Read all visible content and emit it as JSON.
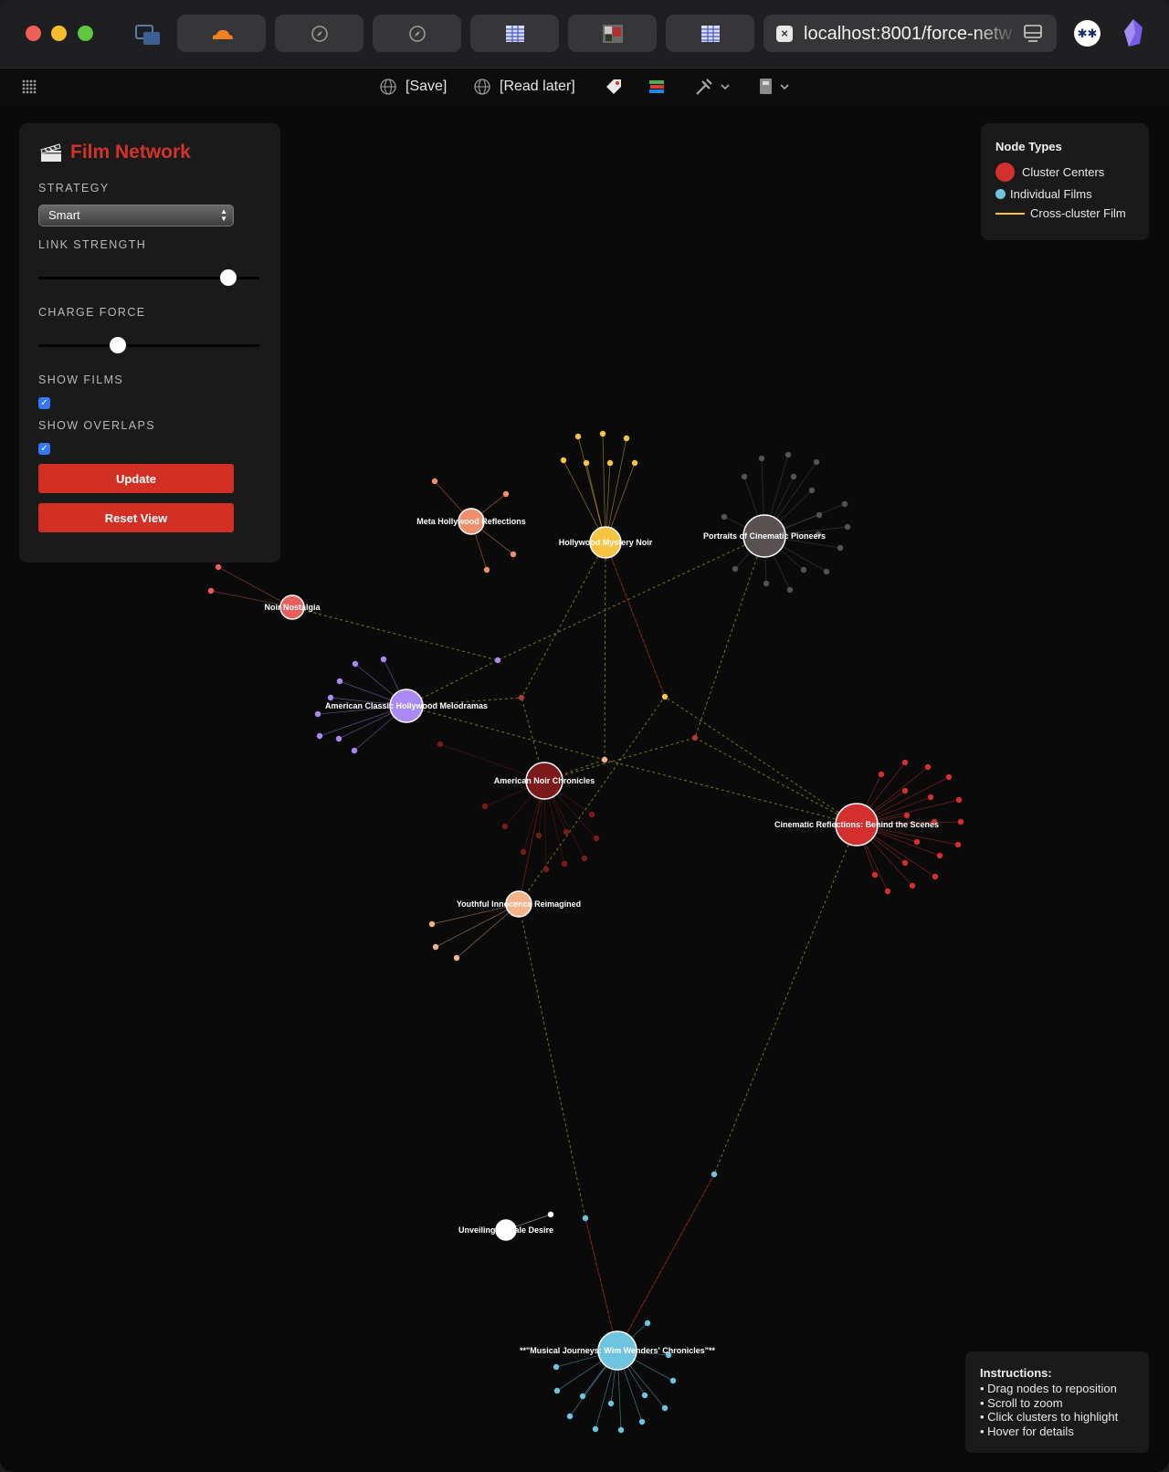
{
  "browser": {
    "url": "localhost:8001/force-netw",
    "tabs": [
      {
        "icon": "cloudflare-icon"
      },
      {
        "icon": "compass-icon"
      },
      {
        "icon": "compass-icon"
      },
      {
        "icon": "table-icon"
      },
      {
        "icon": "film-thumbnail-icon"
      },
      {
        "icon": "table-icon"
      }
    ],
    "extension_label": "✱✱"
  },
  "bookmarks": {
    "save": "[Save]",
    "read_later": "[Read later]"
  },
  "controls": {
    "title": "Film Network",
    "strategy_label": "STRATEGY",
    "strategy_value": "Smart",
    "link_strength_label": "LINK STRENGTH",
    "link_strength_value": 0.86,
    "charge_force_label": "CHARGE FORCE",
    "charge_force_value": 0.36,
    "show_films_label": "SHOW FILMS",
    "show_films": true,
    "show_overlaps_label": "SHOW OVERLAPS",
    "show_overlaps": true,
    "update_label": "Update",
    "reset_label": "Reset View"
  },
  "legend": {
    "title": "Node Types",
    "items": [
      {
        "label": "Cluster Centers",
        "color": "#d32f2f"
      },
      {
        "label": "Individual Films",
        "color": "#6ec3de"
      },
      {
        "label": "Cross-cluster Film",
        "color": "#f6c343"
      }
    ]
  },
  "instructions": {
    "title": "Instructions:",
    "items": [
      "• Drag nodes to reposition",
      "• Scroll to zoom",
      "• Click clusters to highlight",
      "• Hover for details"
    ]
  },
  "colors": {
    "accent": "#d32f2f",
    "overlap_link": "#8a8a2a"
  },
  "clusters": [
    {
      "id": "meta",
      "label": "Meta Hollywood Reflections",
      "color": "#f0906a"
    },
    {
      "id": "mystery",
      "label": "Hollywood Mystery Noir",
      "color": "#f6c343"
    },
    {
      "id": "pioneers",
      "label": "Portraits of Cinematic Pioneers",
      "color": "#575151"
    },
    {
      "id": "nostalgia",
      "label": "Noir Nostalgia",
      "color": "#e85e5e"
    },
    {
      "id": "melodramas",
      "label": "American Classic Hollywood Melodramas",
      "color": "#a98af2"
    },
    {
      "id": "chronicles",
      "label": "American Noir Chronicles",
      "color": "#7b1a1a"
    },
    {
      "id": "behind",
      "label": "Cinematic Reflections: Behind the Scenes",
      "color": "#d32f2f"
    },
    {
      "id": "youthful",
      "label": "Youthful Innocence Reimagined",
      "color": "#f4b488"
    },
    {
      "id": "desire",
      "label": "Unveiling Female Desire",
      "color": "#ffffff"
    },
    {
      "id": "wenders",
      "label": "**\"Musical Journeys: Wim Wenders' Chronicles\"**",
      "color": "#6ec3de"
    }
  ]
}
